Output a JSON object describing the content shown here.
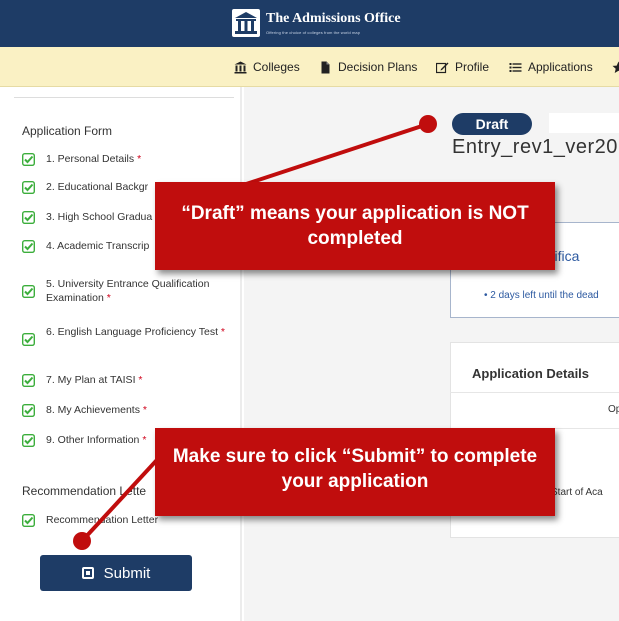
{
  "header": {
    "title": "The Admissions Office",
    "tagline": "Offering the choice of colleges from the world map"
  },
  "nav": [
    {
      "icon": "bank-icon",
      "label": "Colleges"
    },
    {
      "icon": "document-icon",
      "label": "Decision Plans"
    },
    {
      "icon": "edit-icon",
      "label": "Profile"
    },
    {
      "icon": "list-icon",
      "label": "Applications"
    }
  ],
  "sidebar": {
    "form_title": "Application Form",
    "form_items": [
      {
        "label": "1. Personal Details",
        "required": "*"
      },
      {
        "label": "2. Educational Backgr",
        "required": ""
      },
      {
        "label": "3. High School Gradua",
        "required": ""
      },
      {
        "label": "4. Academic Transcrip",
        "required": ""
      },
      {
        "label": "5. University Entrance Qualification Examination",
        "required": "*"
      },
      {
        "label": "6. English Language Proficiency Test",
        "required": "*"
      },
      {
        "label": "7. My Plan at TAISI",
        "required": "*"
      },
      {
        "label": "8. My Achievements",
        "required": "*"
      },
      {
        "label": "9. Other Information",
        "required": "*"
      }
    ],
    "rec_title": "Recommendation Lette",
    "rec_items": [
      {
        "label": "Recommendation Letter",
        "required": ""
      }
    ],
    "submit_label": "Submit"
  },
  "main": {
    "status_badge": "Draft",
    "app_title": "Entry_rev1_ver20",
    "notice_title": "e Notifica",
    "notice_text": "• 2 days left until the dead",
    "details_title": "Application Details",
    "details_rows": [
      "Op",
      "Start of Aca"
    ]
  },
  "callouts": [
    {
      "text": "“Draft” means your application is NOT completed"
    },
    {
      "text": "Make sure to click “Submit” to complete your application"
    }
  ],
  "colors": {
    "header_bg": "#1e3c66",
    "nav_bg": "#faf1c4",
    "callout_red": "#c00d0d",
    "check_green": "#3cae3c",
    "link_blue": "#2d5aa1"
  }
}
